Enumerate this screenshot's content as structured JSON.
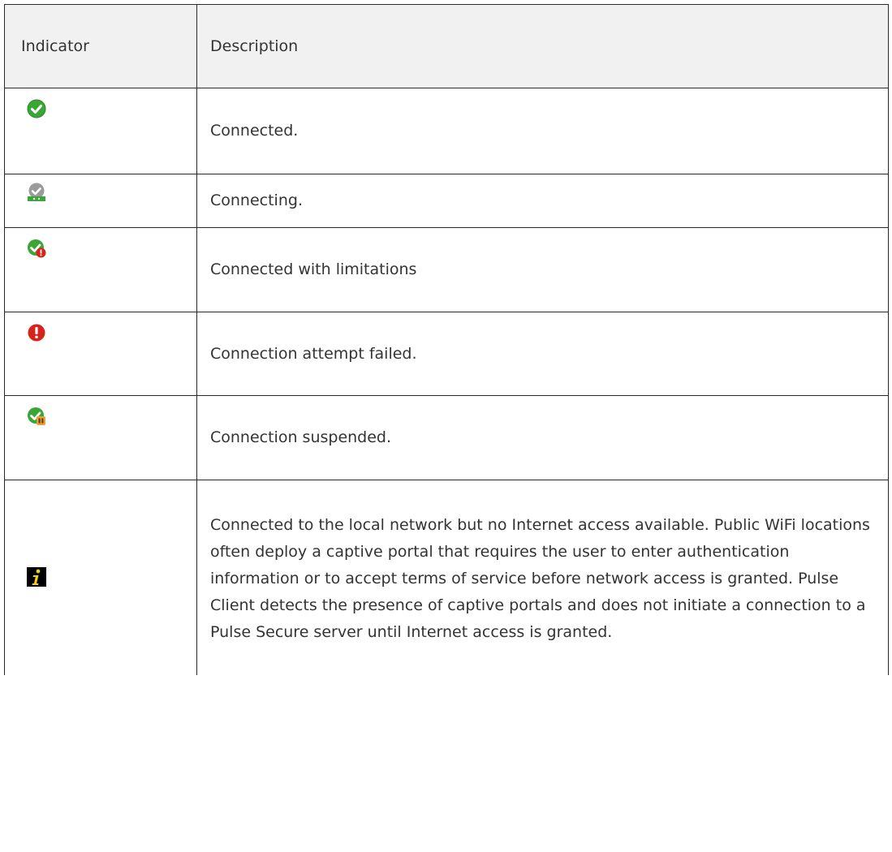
{
  "table": {
    "headers": {
      "indicator": "Indicator",
      "description": "Description"
    },
    "rows": [
      {
        "icon": "green-check-circle-icon",
        "description": "Connected."
      },
      {
        "icon": "gray-check-connecting-icon",
        "description": "Connecting."
      },
      {
        "icon": "green-check-with-red-alert-icon",
        "description": "Connected with limitations"
      },
      {
        "icon": "red-exclamation-circle-icon",
        "description": "Connection attempt failed."
      },
      {
        "icon": "green-check-with-pause-icon",
        "description": "Connection suspended."
      },
      {
        "icon": "yellow-info-icon",
        "description": "Connected to the local network but no Internet access available. Public WiFi locations often deploy a captive portal that requires the user to enter authentication information or to accept terms of service before network access is granted. Pulse Client detects the presence of captive portals and does not initiate a connection to a Pulse Secure server until Internet access is granted."
      }
    ]
  },
  "colors": {
    "green": "#3aa635",
    "red": "#d8221c",
    "gray": "#9b9b9b",
    "yellow": "#f3d400",
    "border": "#2a2a2a",
    "header_bg": "#f1f1f1"
  }
}
